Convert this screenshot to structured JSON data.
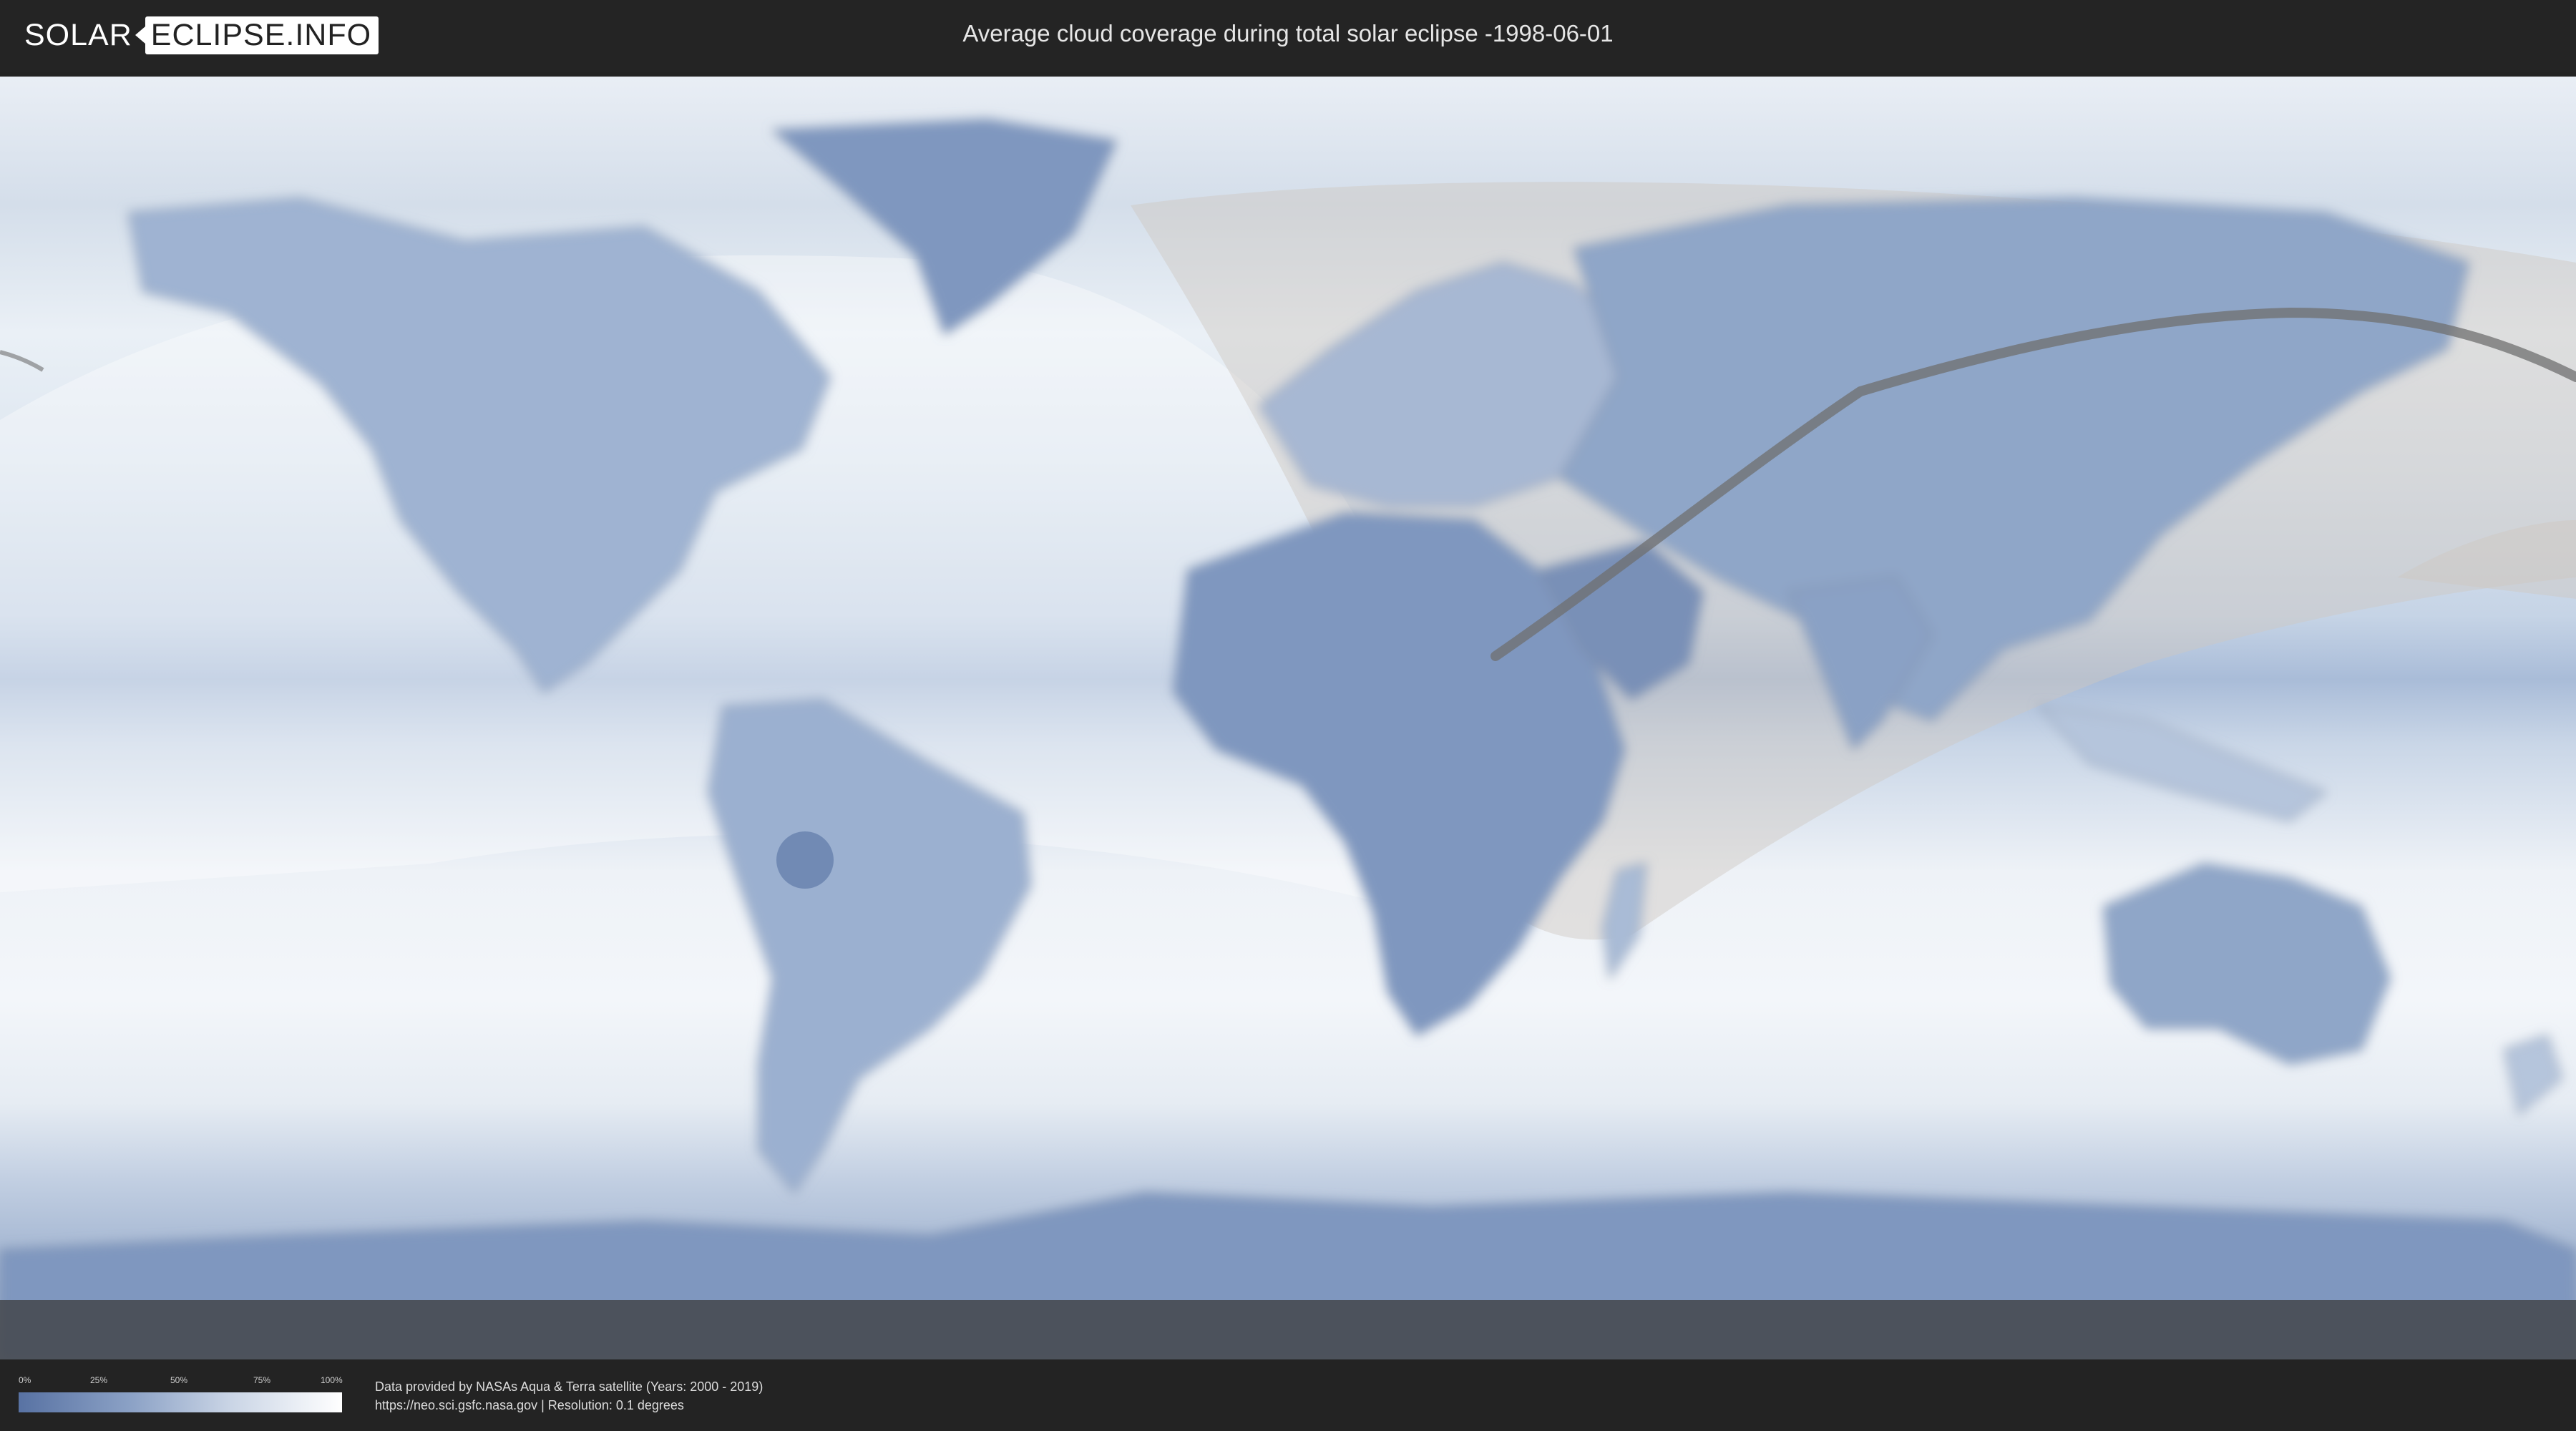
{
  "header": {
    "logo_left": "SOLAR",
    "logo_right": "ECLIPSE.INFO",
    "title": "Average cloud coverage during total solar eclipse -1998-06-01"
  },
  "legend": {
    "ticks": [
      "0%",
      "25%",
      "50%",
      "75%",
      "100%"
    ],
    "colors": [
      "#5872a3",
      "#8ca2c6",
      "#c9d4e5",
      "#ffffff"
    ]
  },
  "footer": {
    "source_line1": "Data provided by NASAs Aqua & Terra satellite (Years: 2000 - 2019)",
    "source_line2": "https://neo.sci.gsfc.nasa.gov | Resolution: 0.1 degrees"
  },
  "map": {
    "colors": {
      "ocean_clear": "#eef2f7",
      "cloud_low": "#7f97bf",
      "cloud_mid": "#a9bbd6",
      "eclipse_overlay": "#c8c3bd",
      "eclipse_path": "#6f6f6f",
      "coast": "#8a95a3"
    }
  }
}
